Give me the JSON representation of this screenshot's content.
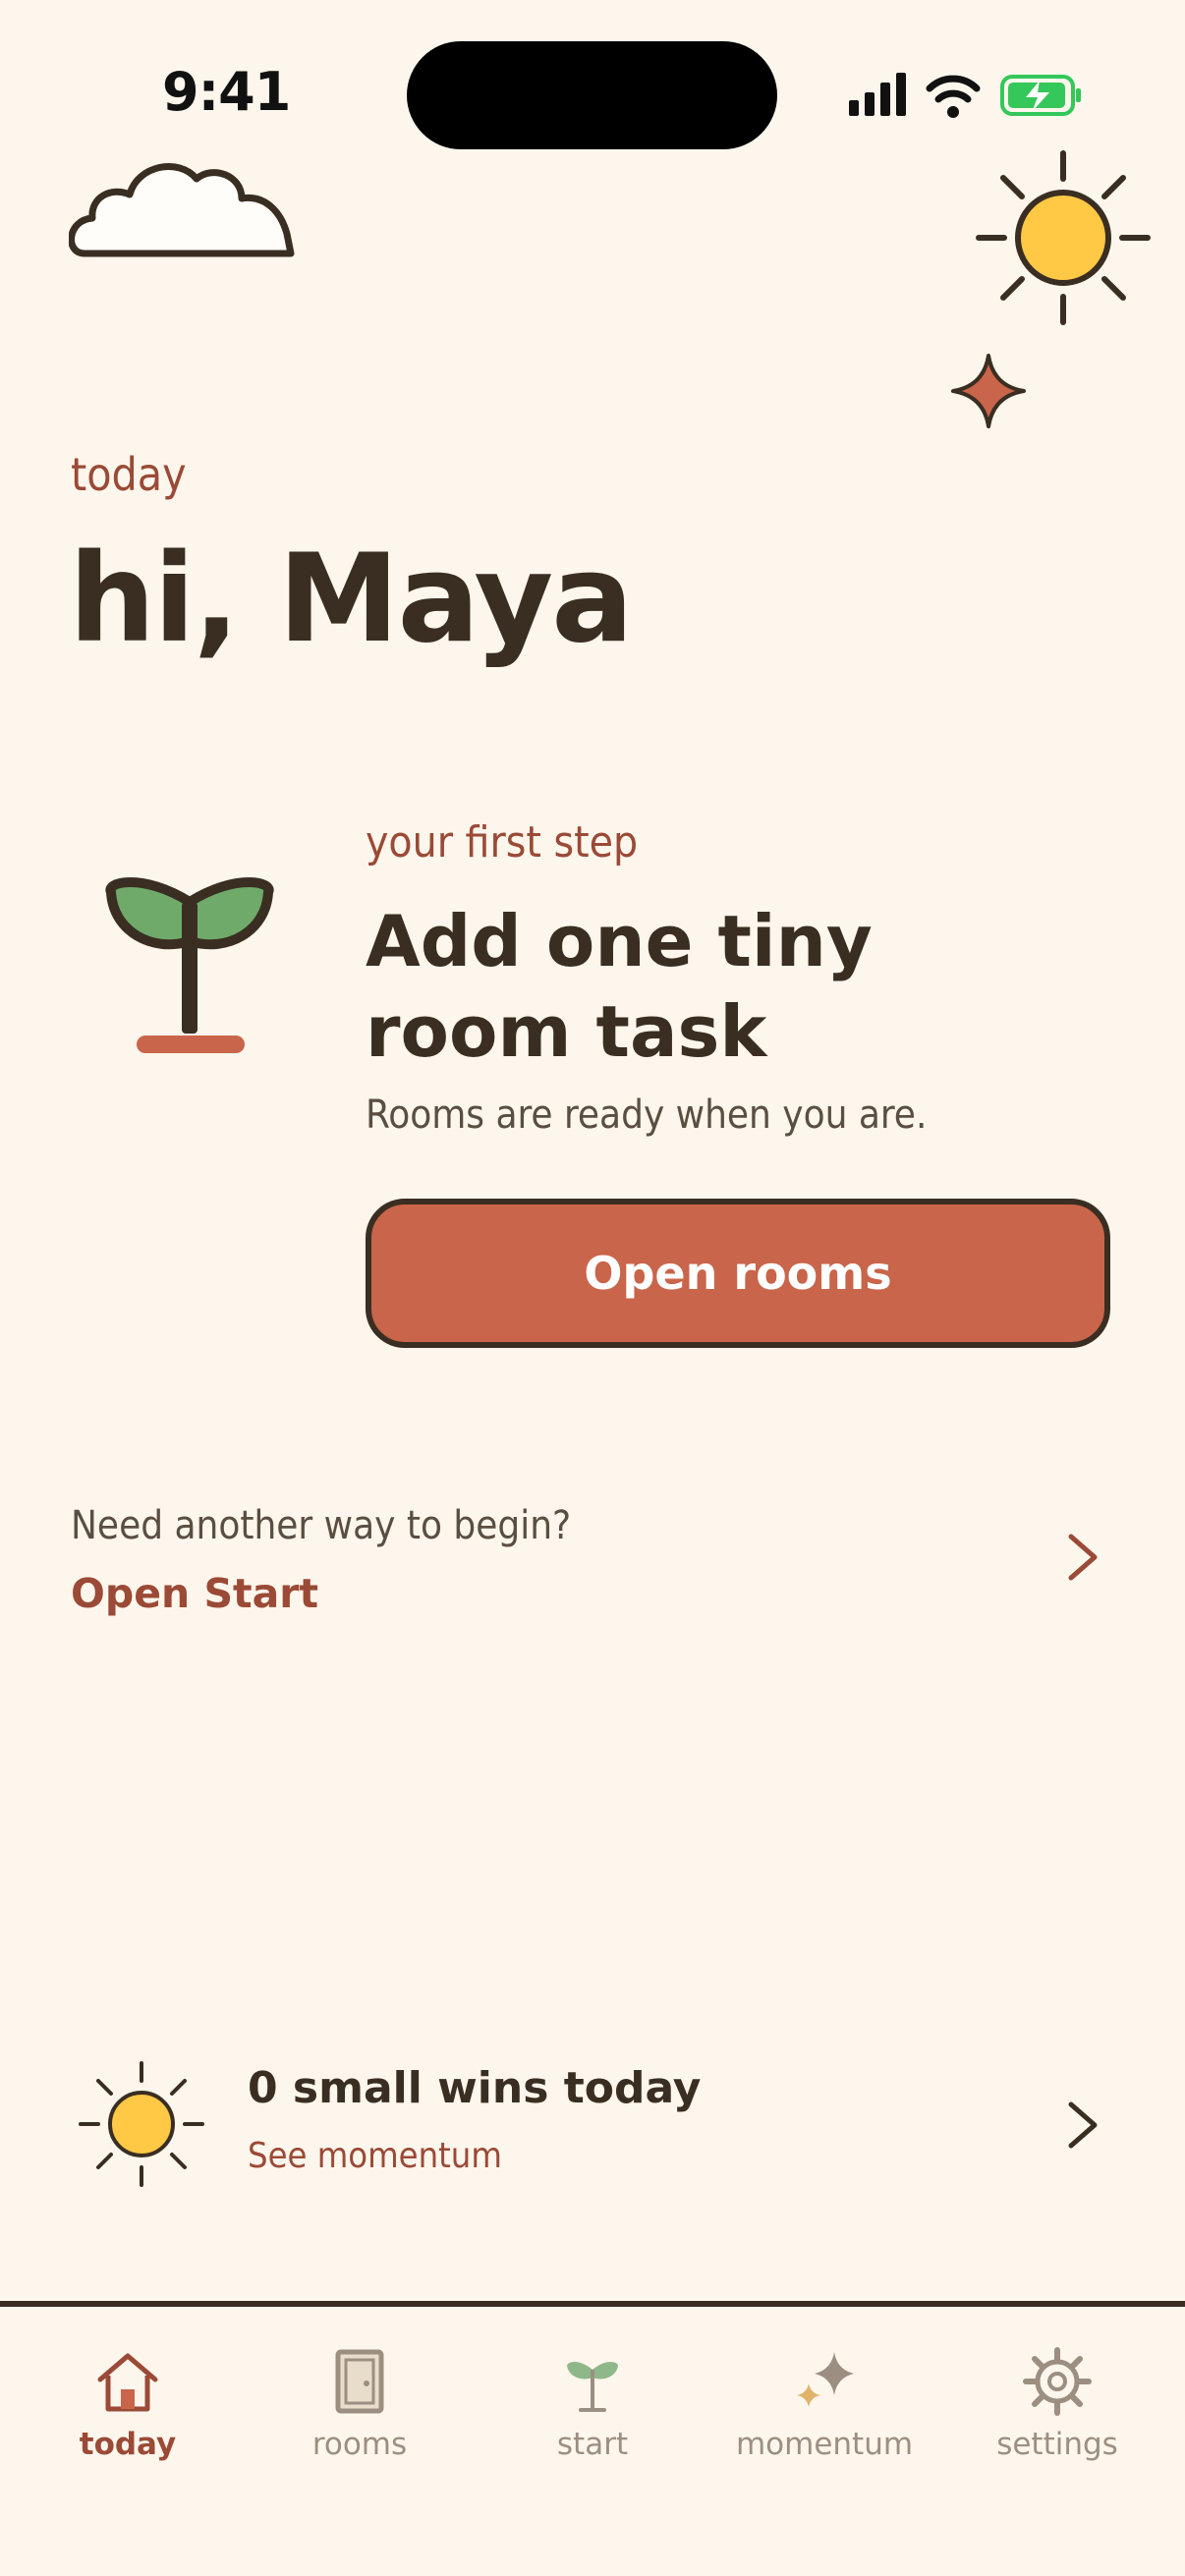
{
  "status_bar": {
    "time": "9:41"
  },
  "header": {
    "eyebrow": "today",
    "greeting": "hi, Maya"
  },
  "card": {
    "eyebrow": "your first step",
    "title": "Add one tiny room task",
    "subtitle": "Rooms are ready when you are.",
    "button_label": "Open rooms"
  },
  "alt": {
    "question": "Need another way to begin?",
    "link_label": "Open Start"
  },
  "wins": {
    "title": "0 small wins today",
    "link_label": "See momentum"
  },
  "tabs": [
    {
      "label": "today",
      "icon": "home-icon",
      "active": true
    },
    {
      "label": "rooms",
      "icon": "door-icon",
      "active": false
    },
    {
      "label": "start",
      "icon": "sprout-icon",
      "active": false
    },
    {
      "label": "momentum",
      "icon": "sparkles-icon",
      "active": false
    },
    {
      "label": "settings",
      "icon": "gear-icon",
      "active": false
    }
  ],
  "colors": {
    "background": "#FDF6EC",
    "ink": "#3A2E22",
    "accent": "#C9654A",
    "accent_text": "#9A4A36",
    "sun": "#FFC845",
    "leaf": "#6FAA6A",
    "battery": "#34C759"
  }
}
